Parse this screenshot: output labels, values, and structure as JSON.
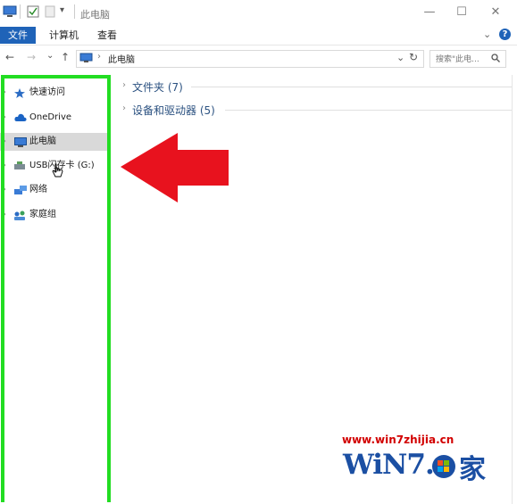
{
  "window": {
    "title": "此电脑",
    "controls": {
      "minimize": "—",
      "maximize": "☐",
      "close": "✕"
    }
  },
  "ribbon": {
    "tabs": [
      "文件",
      "计算机",
      "查看"
    ],
    "expand_chevron": "⌄",
    "help": "?"
  },
  "navigation": {
    "back": "←",
    "forward": "→",
    "recent": "⌄",
    "up": "↑",
    "address": "此电脑",
    "address_dropdown": "⌄",
    "refresh": "↻",
    "search_placeholder": "搜索\"此电...",
    "search_icon": "search-icon"
  },
  "sidebar": {
    "items": [
      {
        "label": "快速访问",
        "icon": "star-icon",
        "selected": false
      },
      {
        "label": "OneDrive",
        "icon": "cloud-icon",
        "selected": false
      },
      {
        "label": "此电脑",
        "icon": "computer-icon",
        "selected": true
      },
      {
        "label": "USB闪存卡 (G:)",
        "icon": "usb-drive-icon",
        "selected": false
      },
      {
        "label": "网络",
        "icon": "network-icon",
        "selected": false
      },
      {
        "label": "家庭组",
        "icon": "homegroup-icon",
        "selected": false
      }
    ]
  },
  "content": {
    "groups": [
      {
        "label": "文件夹 (7)"
      },
      {
        "label": "设备和驱动器 (5)"
      }
    ]
  },
  "annotations": {
    "arrow_color": "#e8121e",
    "highlight_color": "#22dd22"
  },
  "watermark": {
    "url": "www.win7zhijia.cn",
    "logo_text": "WiN7.",
    "logo_char": "家"
  }
}
